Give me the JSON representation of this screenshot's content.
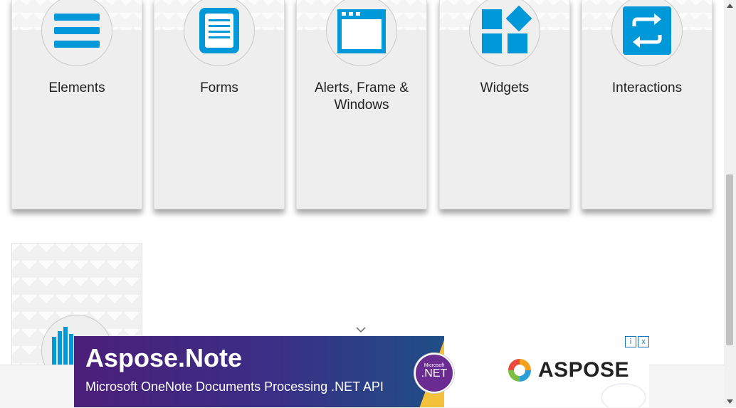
{
  "cards": [
    {
      "label": "Elements"
    },
    {
      "label": "Forms"
    },
    {
      "label": "Alerts, Frame & Windows"
    },
    {
      "label": "Widgets"
    },
    {
      "label": "Interactions"
    }
  ],
  "ad": {
    "title": "Aspose.Note",
    "subtitle": "Microsoft OneNote Documents Processing .NET API",
    "badge_small": "Microsoft",
    "badge_big": ".NET",
    "brand": "ASPOSE",
    "info_icon": "i",
    "close_icon": "x"
  },
  "colors": {
    "accent": "#0098d8"
  }
}
